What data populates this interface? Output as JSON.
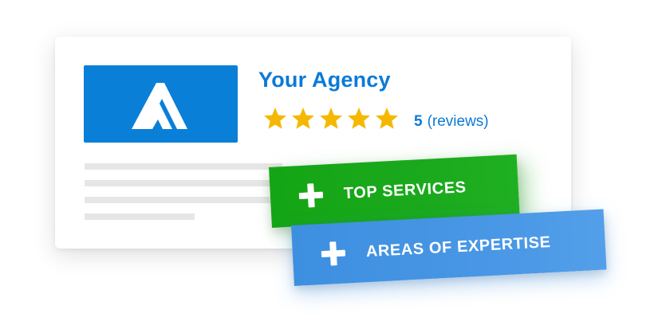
{
  "agency": {
    "name": "Your Agency",
    "rating_value": "5",
    "reviews_label": "(reviews)",
    "stars": 5,
    "logo_icon": "agency-a-logo-icon"
  },
  "badges": [
    {
      "label": "TOP SERVICES",
      "icon": "plus-icon"
    },
    {
      "label": "AREAS OF EXPERTISE",
      "icon": "plus-icon"
    }
  ],
  "colors": {
    "brand_blue": "#0a7fd8",
    "star_gold": "#f5b800",
    "badge_green": "#17a818",
    "badge_blue": "#4596e4",
    "placeholder_gray": "#e6e6e6"
  }
}
